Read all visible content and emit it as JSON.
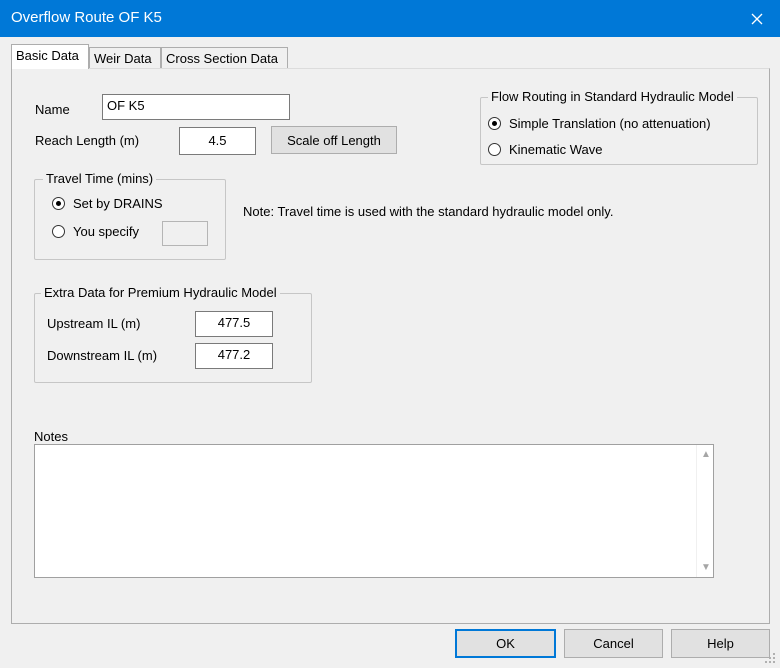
{
  "window": {
    "title": "Overflow Route OF K5"
  },
  "tabs": [
    {
      "label": "Basic Data",
      "active": true
    },
    {
      "label": "Weir Data",
      "active": false
    },
    {
      "label": "Cross Section Data",
      "active": false
    }
  ],
  "basic": {
    "name_label": "Name",
    "name_value": "OF K5",
    "reach_label": "Reach Length (m)",
    "reach_value": "4.5",
    "scale_button": "Scale off Length"
  },
  "travel_time": {
    "legend": "Travel Time (mins)",
    "set_by_drains": "Set by DRAINS",
    "you_specify": "You specify",
    "specify_value": "",
    "selected": "set_by_drains"
  },
  "note": "Note: Travel time is used with the standard hydraulic model only.",
  "flow_routing": {
    "legend": "Flow Routing in Standard Hydraulic Model",
    "simple": "Simple Translation (no attenuation)",
    "kinematic": "Kinematic Wave",
    "selected": "simple"
  },
  "premium": {
    "legend": "Extra Data for Premium Hydraulic Model",
    "upstream_label": "Upstream IL (m)",
    "upstream_value": "477.5",
    "downstream_label": "Downstream IL (m)",
    "downstream_value": "477.2"
  },
  "notes": {
    "label": "Notes",
    "value": ""
  },
  "buttons": {
    "ok": "OK",
    "cancel": "Cancel",
    "help": "Help"
  },
  "icons": {
    "close": "close-icon",
    "scroll_up": "scroll-up-icon",
    "scroll_down": "scroll-down-icon",
    "grip": "resize-grip-icon"
  }
}
